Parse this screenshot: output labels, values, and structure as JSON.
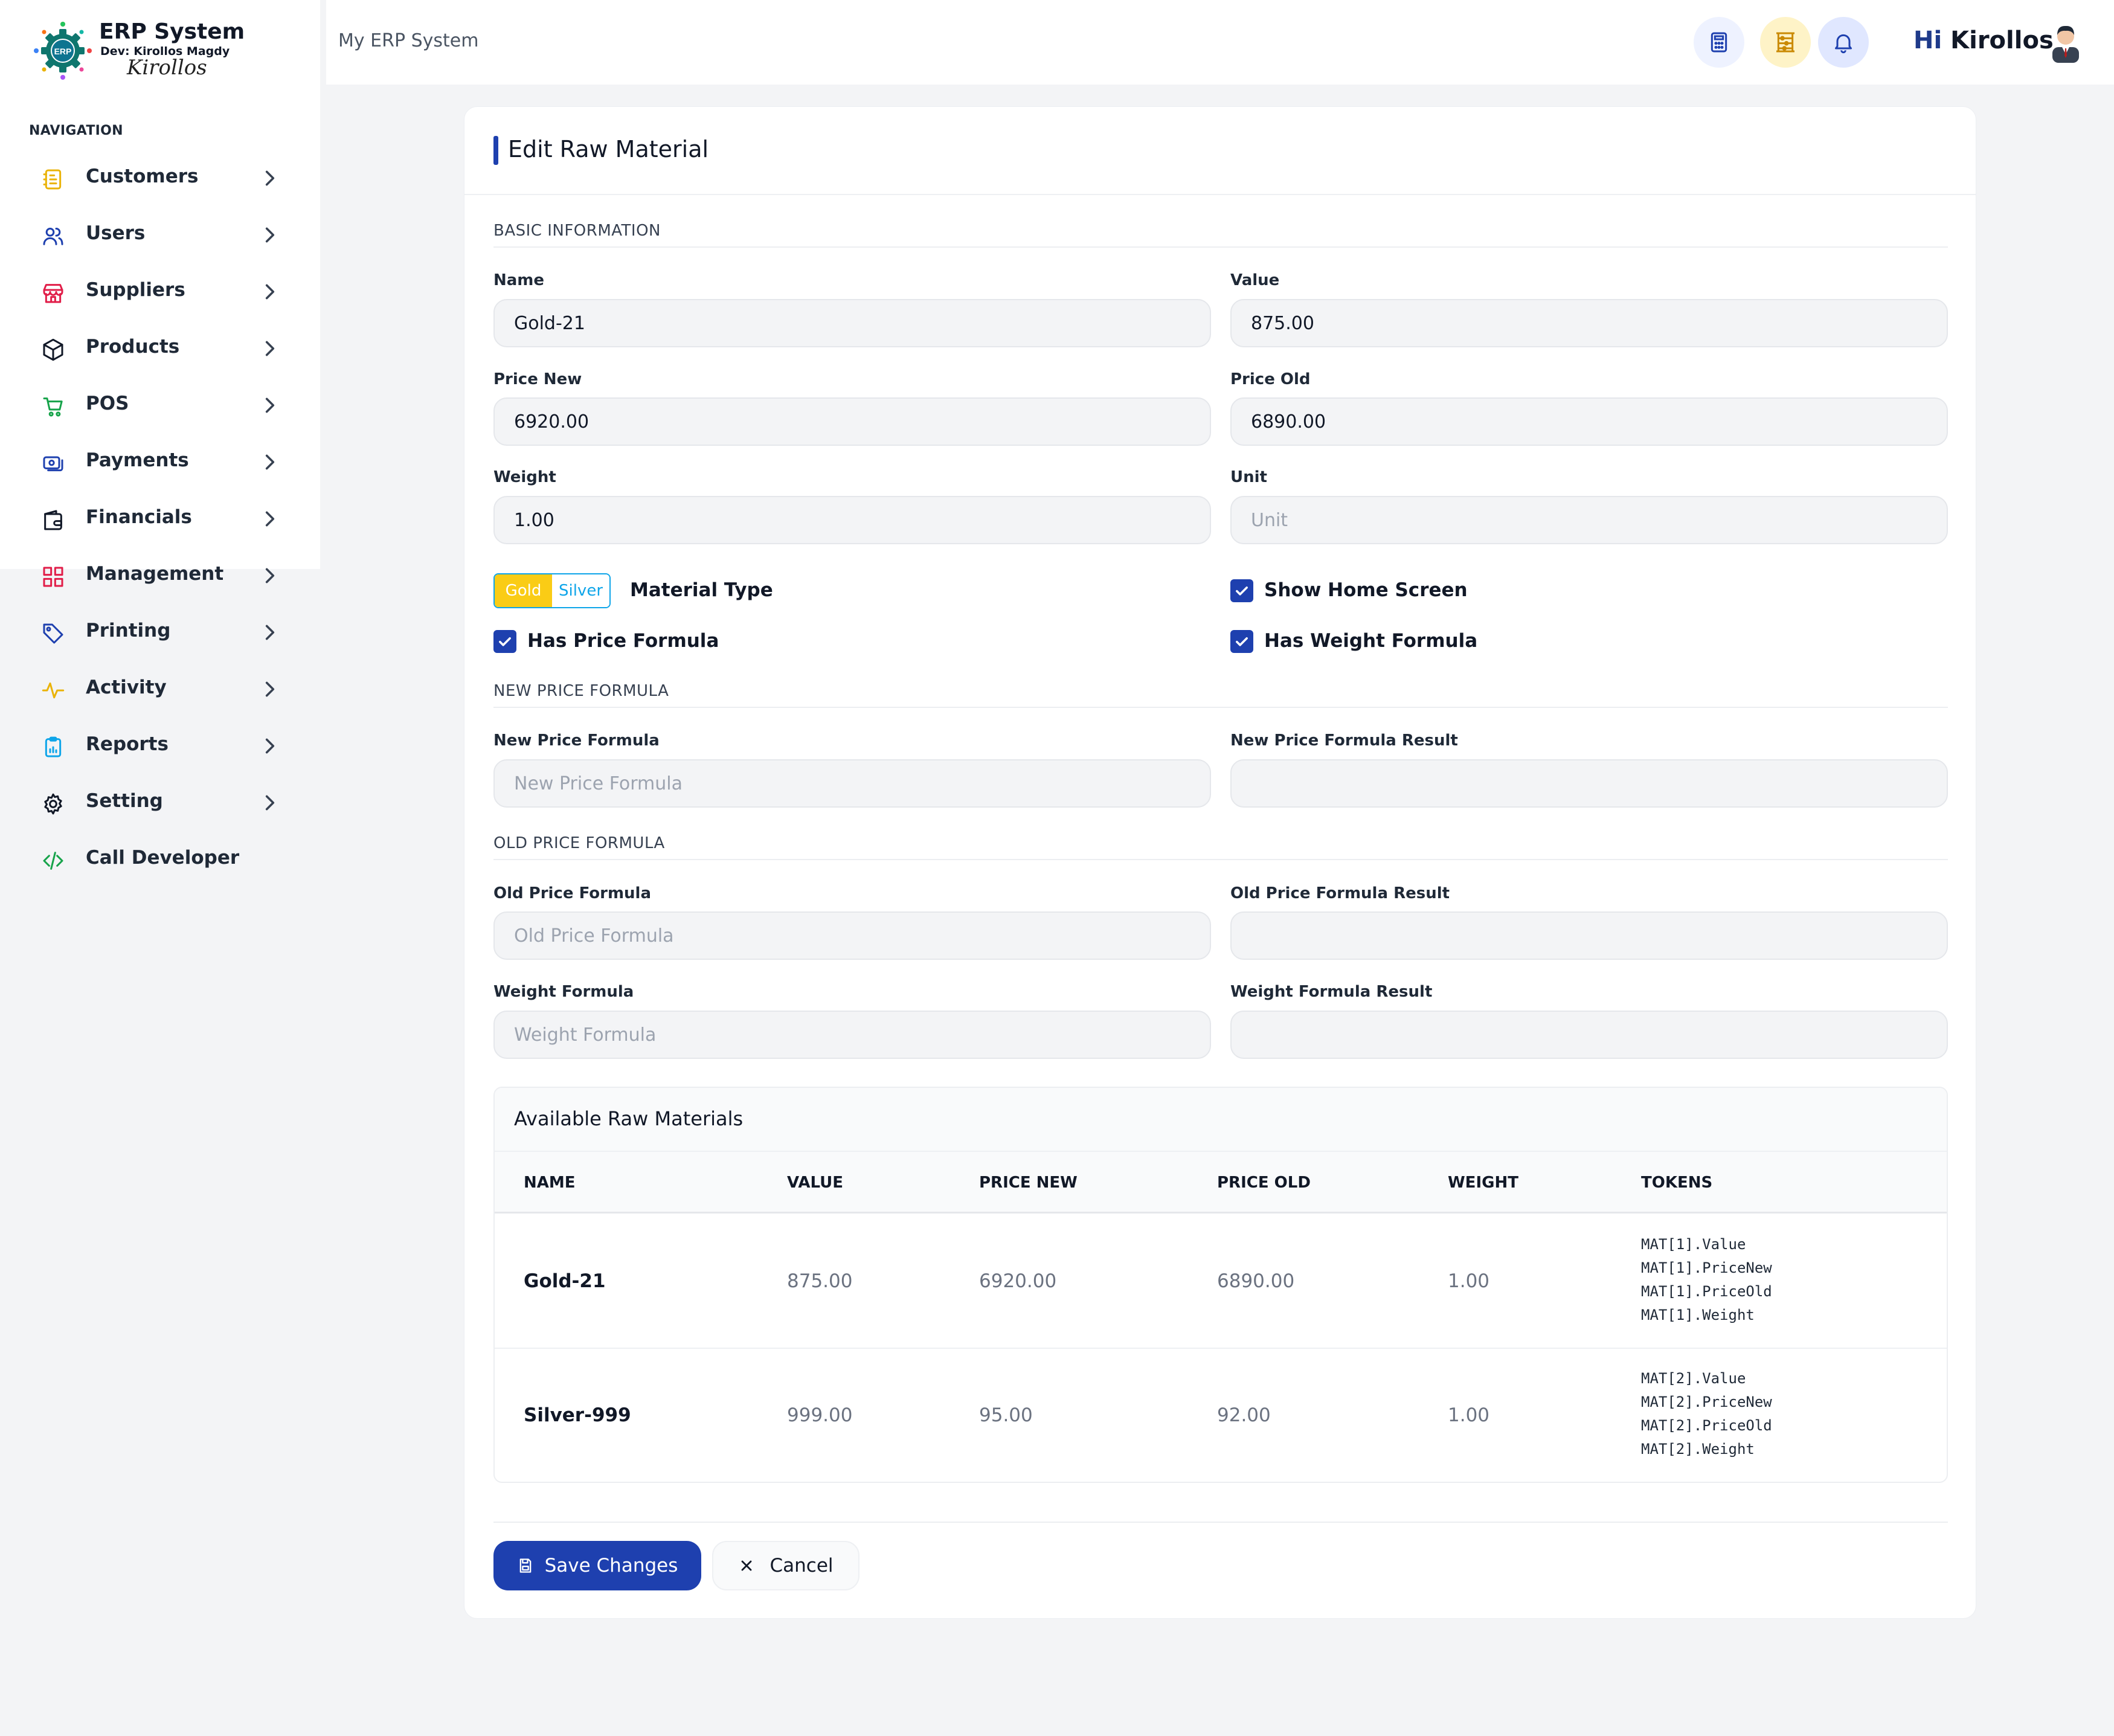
{
  "brand": {
    "title": "ERP System",
    "dev": "Dev: Kirollos Magdy",
    "signature": "Kirollos",
    "logo_text": "ERP"
  },
  "sidebar": {
    "heading": "NAVIGATION",
    "items": [
      {
        "label": "Customers",
        "icon": "customers-icon",
        "color": "#eab308",
        "has_chevron": true
      },
      {
        "label": "Users",
        "icon": "users-icon",
        "color": "#1e40af",
        "has_chevron": true
      },
      {
        "label": "Suppliers",
        "icon": "store-icon",
        "color": "#e11d48",
        "has_chevron": true
      },
      {
        "label": "Products",
        "icon": "box-icon",
        "color": "#111827",
        "has_chevron": true
      },
      {
        "label": "POS",
        "icon": "cart-icon",
        "color": "#16a34a",
        "has_chevron": true
      },
      {
        "label": "Payments",
        "icon": "payments-icon",
        "color": "#1e40af",
        "has_chevron": true
      },
      {
        "label": "Financials",
        "icon": "wallet-icon",
        "color": "#111827",
        "has_chevron": true
      },
      {
        "label": "Management",
        "icon": "grid-icon",
        "color": "#e11d48",
        "has_chevron": true
      },
      {
        "label": "Printing",
        "icon": "tag-icon",
        "color": "#1e40af",
        "has_chevron": true
      },
      {
        "label": "Activity",
        "icon": "activity-icon",
        "color": "#eab308",
        "has_chevron": true
      },
      {
        "label": "Reports",
        "icon": "clipboard-icon",
        "color": "#0ea5e9",
        "has_chevron": true
      },
      {
        "label": "Setting",
        "icon": "gear-icon",
        "color": "#111827",
        "has_chevron": true
      },
      {
        "label": "Call Developer",
        "icon": "code-icon",
        "color": "#16a34a",
        "has_chevron": false
      }
    ]
  },
  "topbar": {
    "breadcrumb": "My ERP System",
    "greeting_hi": "Hi",
    "greeting_name": "Kirollos",
    "buttons": [
      {
        "icon": "calculator-icon",
        "bg": "#eef2ff",
        "color": "#1e40af"
      },
      {
        "icon": "abacus-icon",
        "bg": "#fef3c7",
        "color": "#ca8a04"
      },
      {
        "icon": "bell-icon",
        "bg": "#e0e7ff",
        "color": "#1e40af"
      }
    ]
  },
  "form": {
    "title": "Edit Raw Material",
    "section_basic": "BASIC INFORMATION",
    "name": {
      "label": "Name",
      "value": "Gold-21",
      "placeholder": ""
    },
    "value": {
      "label": "Value",
      "value": "875.00",
      "placeholder": ""
    },
    "price_new": {
      "label": "Price New",
      "value": "6920.00",
      "placeholder": ""
    },
    "price_old": {
      "label": "Price Old",
      "value": "6890.00",
      "placeholder": ""
    },
    "weight": {
      "label": "Weight",
      "value": "1.00",
      "placeholder": ""
    },
    "unit": {
      "label": "Unit",
      "value": "",
      "placeholder": "Unit"
    },
    "material_type": {
      "label": "Material Type",
      "options": [
        "Gold",
        "Silver"
      ],
      "selected": "Gold"
    },
    "show_home_screen": {
      "label": "Show Home Screen",
      "checked": true
    },
    "has_price_formula": {
      "label": "Has Price Formula",
      "checked": true
    },
    "has_weight_formula": {
      "label": "Has Weight Formula",
      "checked": true
    },
    "section_new_price": "NEW PRICE FORMULA",
    "new_price_formula": {
      "label": "New Price Formula",
      "value": "",
      "placeholder": "New Price Formula"
    },
    "new_price_formula_result": {
      "label": "New Price Formula Result",
      "value": "",
      "placeholder": ""
    },
    "section_old_price": "OLD PRICE FORMULA",
    "old_price_formula": {
      "label": "Old Price Formula",
      "value": "",
      "placeholder": "Old Price Formula"
    },
    "old_price_formula_result": {
      "label": "Old Price Formula Result",
      "value": "",
      "placeholder": ""
    },
    "weight_formula": {
      "label": "Weight Formula",
      "value": "",
      "placeholder": "Weight Formula"
    },
    "weight_formula_result": {
      "label": "Weight Formula Result",
      "value": "",
      "placeholder": ""
    }
  },
  "materials_table": {
    "title": "Available Raw Materials",
    "columns": [
      "NAME",
      "VALUE",
      "PRICE NEW",
      "PRICE OLD",
      "WEIGHT",
      "TOKENS"
    ],
    "rows": [
      {
        "name": "Gold-21",
        "value": "875.00",
        "price_new": "6920.00",
        "price_old": "6890.00",
        "weight": "1.00",
        "tokens": [
          "MAT[1].Value",
          "MAT[1].PriceNew",
          "MAT[1].PriceOld",
          "MAT[1].Weight"
        ]
      },
      {
        "name": "Silver-999",
        "value": "999.00",
        "price_new": "95.00",
        "price_old": "92.00",
        "weight": "1.00",
        "tokens": [
          "MAT[2].Value",
          "MAT[2].PriceNew",
          "MAT[2].PriceOld",
          "MAT[2].Weight"
        ]
      }
    ]
  },
  "actions": {
    "save_label": "Save Changes",
    "cancel_label": "Cancel",
    "save_color": "#1e40af"
  }
}
